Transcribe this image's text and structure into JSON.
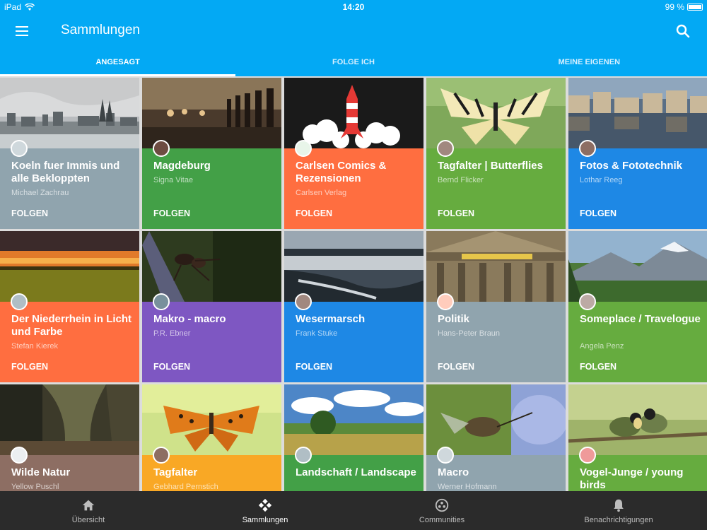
{
  "status_bar": {
    "device": "iPad",
    "time": "14:20",
    "battery": "99 %"
  },
  "app_bar": {
    "title": "Sammlungen",
    "menu_icon": "menu-icon",
    "search_icon": "search-icon"
  },
  "tabs": [
    {
      "label": "ANGESAGT",
      "active": true
    },
    {
      "label": "FOLGE ICH",
      "active": false
    },
    {
      "label": "MEINE EIGENEN",
      "active": false
    }
  ],
  "follow_label": "FOLGEN",
  "cards": [
    {
      "title": "Koeln fuer Immis und alle Bekloppten",
      "owner": "Michael Zachrau",
      "color": "#90a4ae"
    },
    {
      "title": "Magdeburg",
      "owner": "Signa Vitae",
      "color": "#43a047"
    },
    {
      "title": "Carlsen Comics & Rezensionen",
      "owner": "Carlsen Verlag",
      "color": "#ff6e40"
    },
    {
      "title": "Tagfalter   |   Butterflies",
      "owner": "Bernd Flicker",
      "color": "#66ac3f"
    },
    {
      "title": "Fotos & Fototechnik",
      "owner": "Lothar Reeg",
      "color": "#1e88e5"
    },
    {
      "title": "Der Niederrhein in Licht und Farbe",
      "owner": "Stefan Kierek",
      "color": "#ff6e40"
    },
    {
      "title": "Makro - macro",
      "owner": "P.R. Ebner",
      "color": "#7e57c2"
    },
    {
      "title": "Wesermarsch",
      "owner": "Frank Stuke",
      "color": "#1e88e5"
    },
    {
      "title": "Politik",
      "owner": "Hans-Peter Braun",
      "color": "#90a4ae"
    },
    {
      "title": "Someplace / Travelogue",
      "owner": "Angela Penz",
      "color": "#66ac3f"
    },
    {
      "title": "Wilde Natur",
      "owner": "Yellow Puschl",
      "color": "#8d6e63"
    },
    {
      "title": "Tagfalter",
      "owner": "Gebhard Pernstich",
      "color": "#f9a825"
    },
    {
      "title": "Landschaft / Landscape",
      "owner": "",
      "color": "#43a047"
    },
    {
      "title": "Macro",
      "owner": "Werner Hofmann",
      "color": "#90a4ae"
    },
    {
      "title": "Vogel-Junge / young birds",
      "owner": "",
      "color": "#66ac3f"
    }
  ],
  "bottom_nav": [
    {
      "label": "Übersicht",
      "icon": "home-icon",
      "active": false
    },
    {
      "label": "Sammlungen",
      "icon": "collections-icon",
      "active": true
    },
    {
      "label": "Communities",
      "icon": "communities-icon",
      "active": false
    },
    {
      "label": "Benachrichtigungen",
      "icon": "bell-icon",
      "active": false
    }
  ]
}
